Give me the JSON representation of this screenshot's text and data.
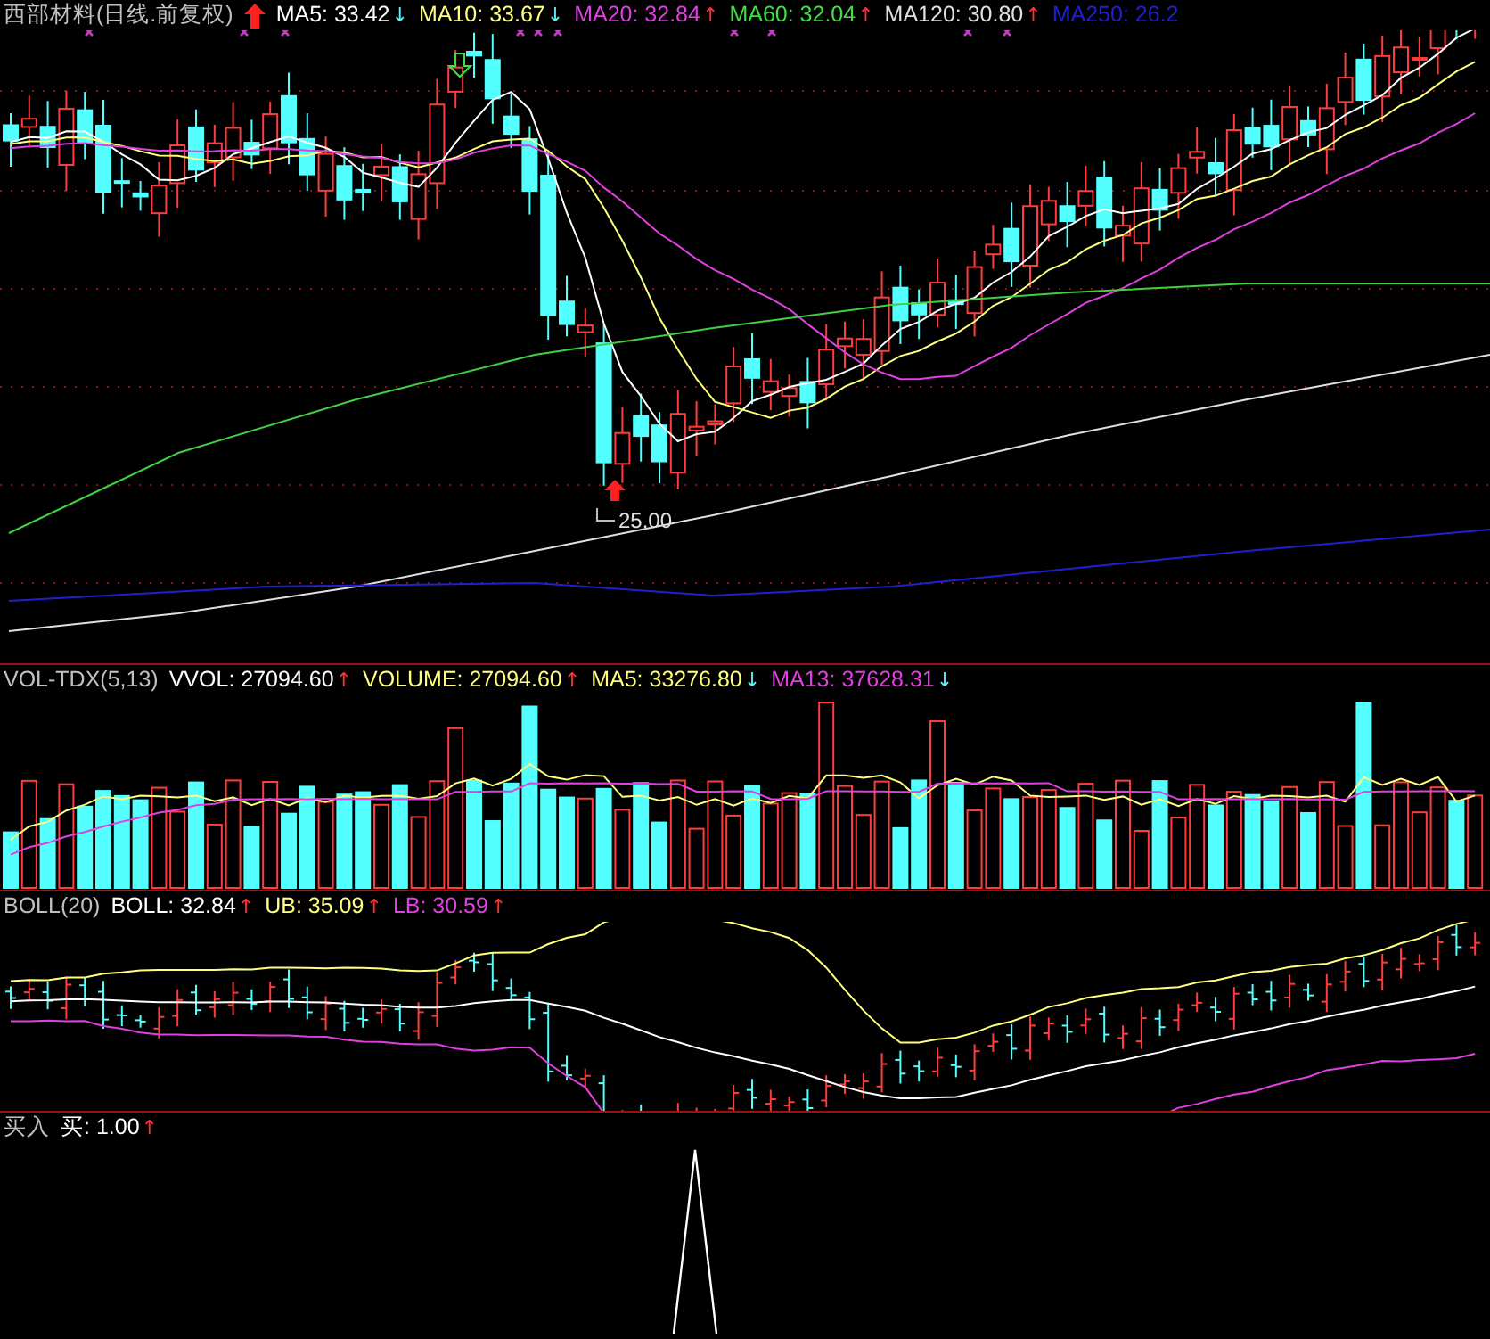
{
  "main_panel": {
    "title": "西部材料(日线.前复权)",
    "signal_up": true,
    "indicators": [
      {
        "label": "MA5: 33.42",
        "color": "#ffffff",
        "arrow": "↓",
        "rising": false
      },
      {
        "label": "MA10: 33.67",
        "color": "#ffff80",
        "arrow": "↓",
        "rising": false
      },
      {
        "label": "MA20: 32.84",
        "color": "#e040e0",
        "arrow": "↑",
        "rising": true
      },
      {
        "label": "MA60: 32.04",
        "color": "#40e040",
        "arrow": "↑",
        "rising": true
      },
      {
        "label": "MA120: 30.80",
        "color": "#e0e0e0",
        "arrow": "↑",
        "rising": true
      },
      {
        "label": "MA250: 26.2",
        "color": "#2020d0"
      }
    ],
    "low_label": "25.00"
  },
  "volume_panel": {
    "title": "VOL-TDX(5,13)",
    "indicators": [
      {
        "label": "VVOL: 27094.60",
        "color": "#ffffff",
        "arrow": "↑",
        "rising": true
      },
      {
        "label": "VOLUME: 27094.60",
        "color": "#ffff80",
        "arrow": "↑",
        "rising": true
      },
      {
        "label": "MA5: 33276.80",
        "color": "#ffff80",
        "arrow": "↓",
        "rising": false
      },
      {
        "label": "MA13: 37628.31",
        "color": "#e040e0",
        "arrow": "↓",
        "rising": false
      }
    ]
  },
  "boll_panel": {
    "title": "BOLL(20)",
    "indicators": [
      {
        "label": "BOLL: 32.84",
        "color": "#ffffff",
        "arrow": "↑",
        "rising": true
      },
      {
        "label": "UB: 35.09",
        "color": "#ffff80",
        "arrow": "↑",
        "rising": true
      },
      {
        "label": "LB: 30.59",
        "color": "#e040e0",
        "arrow": "↑",
        "rising": true
      }
    ]
  },
  "signal_panel": {
    "title": "买入",
    "indicators": [
      {
        "label": "买: 1.00",
        "color": "#ffffff",
        "arrow": "↑",
        "rising": true
      }
    ]
  }
}
